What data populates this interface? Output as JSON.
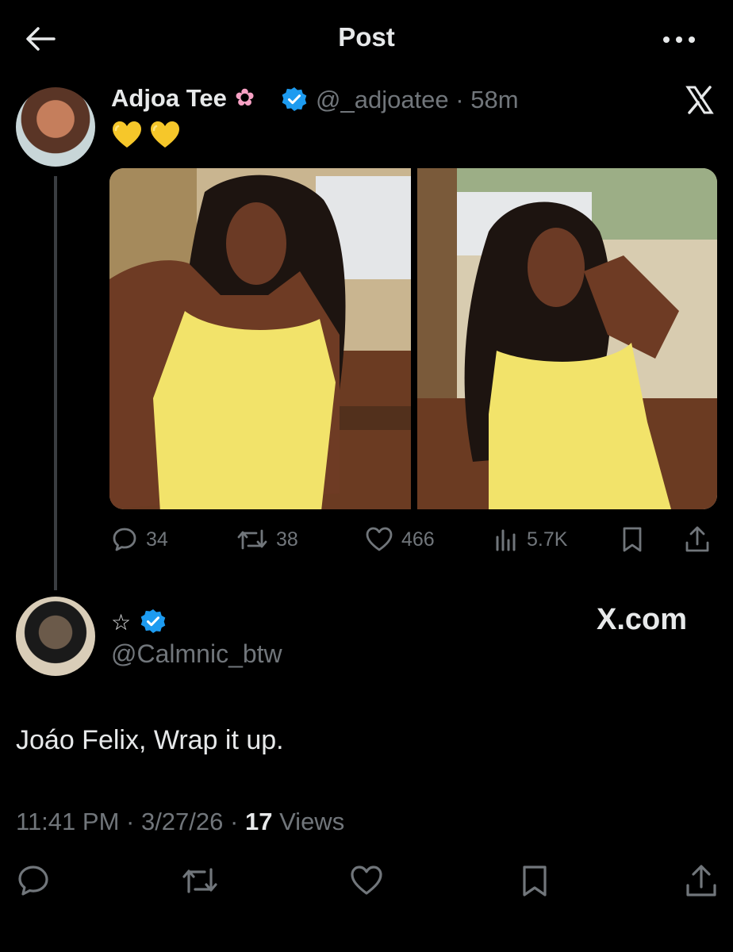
{
  "header": {
    "title": "Post"
  },
  "parent_post": {
    "author_name": "Adjoa Tee",
    "author_name_emoji": "✿",
    "handle": "@_adjoatee",
    "time": "58m",
    "body_emoji": "yellow-heart yellow-heart",
    "stats": {
      "replies": "34",
      "reposts": "38",
      "likes": "466",
      "views": "5.7K"
    }
  },
  "reply_post": {
    "display_name": "☆",
    "handle": "@Calmnic_btw",
    "watermark": "X.com",
    "text": "Joáo Felix, Wrap it up.",
    "time": "11:41 PM",
    "date": "3/27/26",
    "views_count": "17",
    "views_label": "Views"
  },
  "colors": {
    "background": "#000000",
    "text": "#e7e9ea",
    "muted": "#71767b",
    "verified": "#1d9bf0",
    "heart": "#f6c72a"
  }
}
